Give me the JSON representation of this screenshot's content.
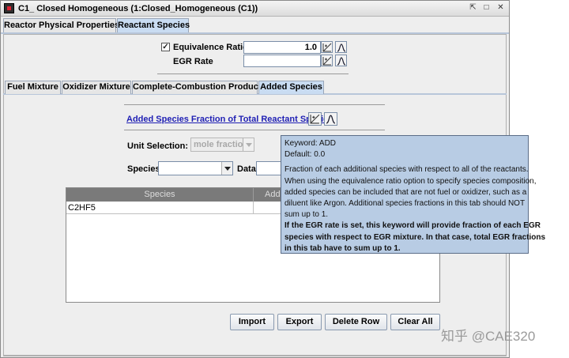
{
  "window": {
    "title": "C1_ Closed Homogeneous  (1:Closed_Homogeneous (C1))",
    "controls": [
      "restore-icon",
      "maximize-icon",
      "close-icon"
    ]
  },
  "top_tabs": [
    {
      "label": "Reactor Physical Properties",
      "selected": false
    },
    {
      "label": "Reactant Species",
      "selected": true
    }
  ],
  "equivalence": {
    "label": "Equivalence Ratio",
    "checked": true,
    "value": "1.0"
  },
  "egr": {
    "label": "EGR Rate",
    "value": ""
  },
  "sub_tabs": [
    {
      "label": "Fuel Mixture",
      "selected": false
    },
    {
      "label": "Oxidizer Mixture",
      "selected": false
    },
    {
      "label": "Complete-Combustion Products",
      "selected": false
    },
    {
      "label": "Added Species",
      "selected": true
    }
  ],
  "added_species": {
    "link_label": "Added Species Fraction of Total Reactant Species",
    "unit_label": "Unit Selection:",
    "unit_value": "mole fraction",
    "species_label": "Species",
    "species_value": "",
    "data_label": "Data",
    "data_value": ""
  },
  "table": {
    "headers": [
      "Species",
      "Adde"
    ],
    "rows": [
      [
        "C2HF5",
        ""
      ]
    ]
  },
  "buttons": {
    "import": "Import",
    "export": "Export",
    "delete_row": "Delete Row",
    "clear_all": "Clear All"
  },
  "tooltip": {
    "keyword": "Keyword: ADD",
    "default": "Default: 0.0",
    "lines": [
      "Fraction of each additional species with respect to all of the reactants.",
      "When using the equivalence ratio option to specify species composition,",
      "added species can be included that are not fuel or oxidizer, such as a",
      "diluent like Argon. Additional species fractions in this tab should NOT",
      "sum up to 1."
    ],
    "bold_lines": [
      "If the EGR rate is set, this keyword will provide fraction of each EGR",
      "species with respect to EGR mixture. In that case, total EGR fractions",
      "in this tab have to sum up to 1."
    ]
  },
  "watermark": "知乎 @CAE320",
  "colors": {
    "tab_selected": "#c9dcf2",
    "tooltip_bg": "#b8cce4",
    "link": "#1f1fb4",
    "table_header": "#7a7a7a"
  }
}
